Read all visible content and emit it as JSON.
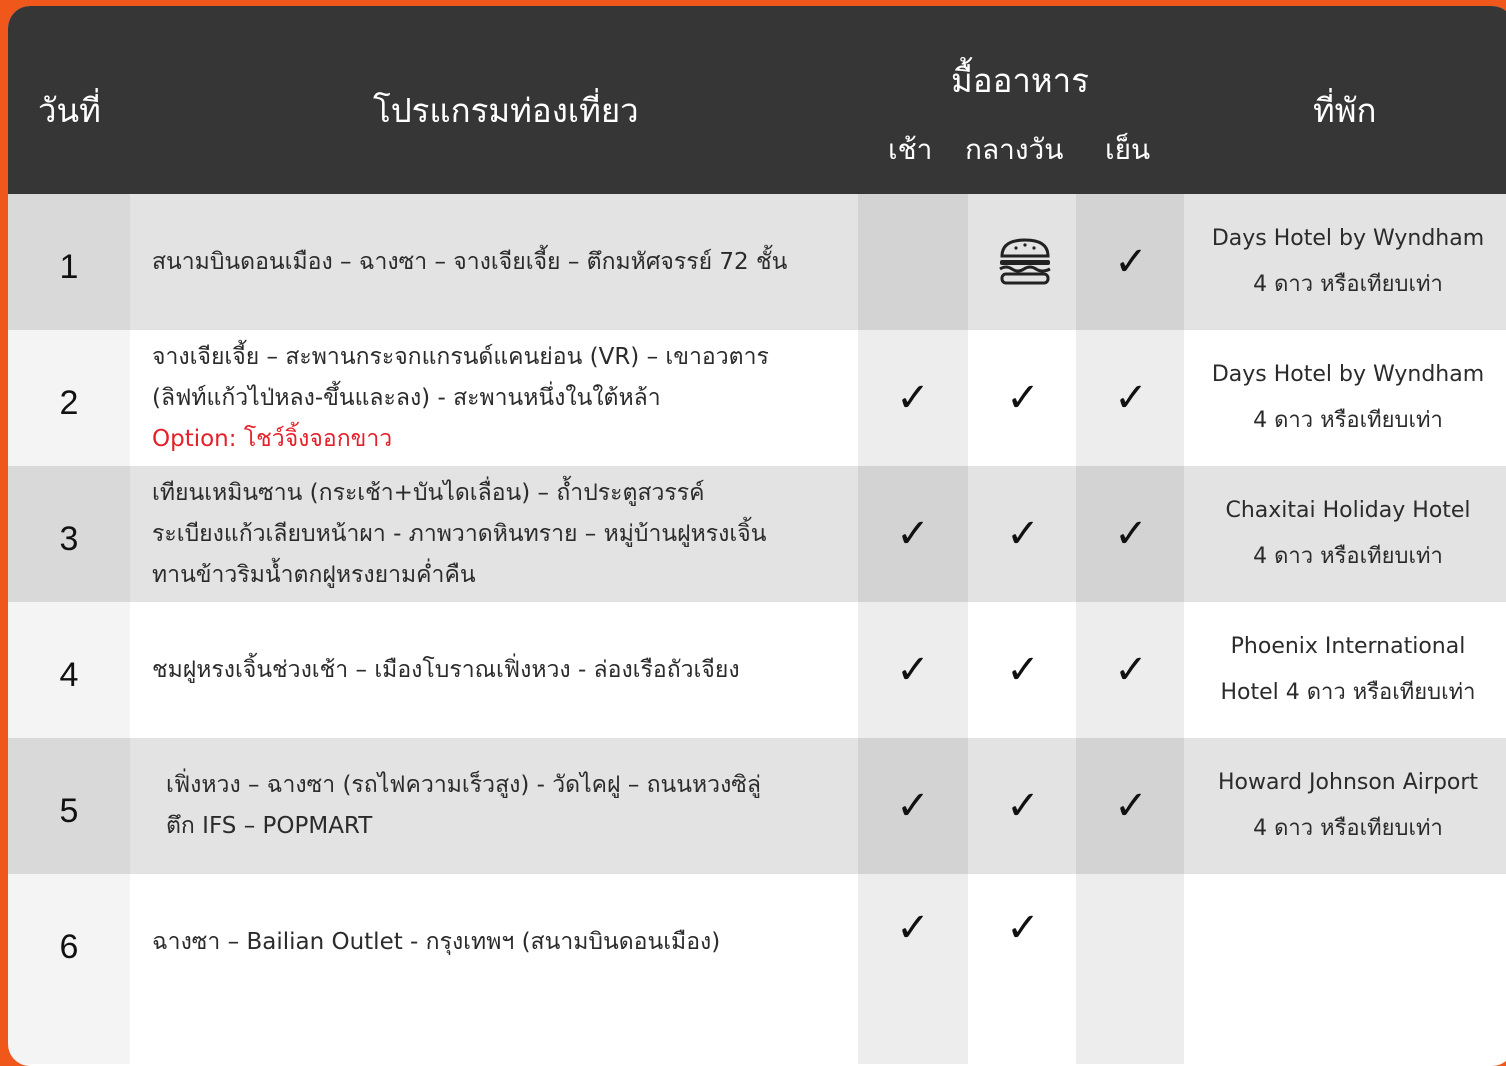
{
  "header": {
    "day": "วันที่",
    "program": "โปรแกรมท่องเที่ยว",
    "meals": "มื้ออาหาร",
    "breakfast": "เช้า",
    "lunch": "กลางวัน",
    "dinner": "เย็น",
    "hotel": "ที่พัก"
  },
  "icons": {
    "check": "check-icon",
    "meal_on_bus": "burger-icon"
  },
  "colors": {
    "frame": "#f0571a",
    "header_bg": "#363636",
    "row_shade": "#e3e3e3",
    "option_text": "#e5202a"
  },
  "rows": [
    {
      "day": "1",
      "program": [
        "สนามบินดอนเมือง – ฉางซา – จางเจียเจี้ย – ตึกมหัศจรรย์ 72 ชั้น"
      ],
      "option": "",
      "breakfast": "",
      "lunch": "burger",
      "dinner": "✓",
      "hotel": [
        "Days Hotel by Wyndham",
        "4 ดาว หรือเทียบเท่า"
      ]
    },
    {
      "day": "2",
      "program": [
        "จางเจียเจี้ย – สะพานกระจกแกรนด์แคนย่อน (VR) – เขาอวตาร",
        "(ลิฟท์แก้วไป่หลง-ขึ้นและลง)  - สะพานหนึ่งในใต้หล้า"
      ],
      "option": "Option: โชว์จิ้งจอกขาว",
      "breakfast": "✓",
      "lunch": "✓",
      "dinner": "✓",
      "hotel": [
        "Days Hotel by Wyndham",
        "4 ดาว หรือเทียบเท่า"
      ]
    },
    {
      "day": "3",
      "program": [
        "เทียนเหมินซาน (กระเช้า+บันไดเลื่อน) – ถ้ำประตูสวรรค์",
        "ระเบียงแก้วเลียบหน้าผา - ภาพวาดหินทราย – หมู่บ้านฝูหรงเจิ้น",
        "ทานข้าวริมน้ำตกฝูหรงยามค่ำคืน"
      ],
      "option": "",
      "breakfast": "✓",
      "lunch": "✓",
      "dinner": "✓",
      "hotel": [
        "Chaxitai Holiday Hotel",
        "4 ดาว หรือเทียบเท่า"
      ]
    },
    {
      "day": "4",
      "program": [
        "ชมฝูหรงเจิ้นช่วงเช้า – เมืองโบราณเฟิ่งหวง - ล่องเรือถัวเจียง"
      ],
      "option": "",
      "breakfast": "✓",
      "lunch": "✓",
      "dinner": "✓",
      "hotel": [
        "Phoenix International",
        "Hotel 4 ดาว หรือเทียบเท่า"
      ]
    },
    {
      "day": "5",
      "program": [
        "เฟิ่งหวง – ฉางซา  (รถไฟความเร็วสูง) - วัดไคฝู – ถนนหวงซิลู่",
        "ตึก IFS – POPMART"
      ],
      "option": "",
      "breakfast": "✓",
      "lunch": "✓",
      "dinner": "✓",
      "hotel": [
        "Howard Johnson Airport",
        "4 ดาว หรือเทียบเท่า"
      ]
    },
    {
      "day": "6",
      "program": [
        "ฉางซา – Bailian Outlet - กรุงเทพฯ (สนามบินดอนเมือง)"
      ],
      "option": "",
      "breakfast": "✓",
      "lunch": "✓",
      "dinner": "",
      "hotel": []
    }
  ]
}
